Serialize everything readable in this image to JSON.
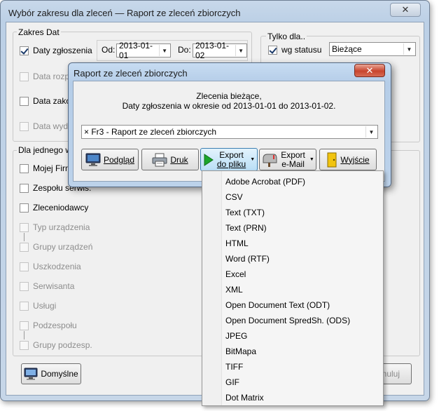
{
  "window": {
    "title": "Wybór zakresu dla zleceń — Raport ze zleceń zbiorczych",
    "close_glyph": "✕"
  },
  "zakres_dat": {
    "legend": "Zakres Dat",
    "rows": [
      {
        "label": "Daty zgłoszenia",
        "checked": true,
        "enabled": true
      },
      {
        "label": "Data rozpo",
        "checked": false,
        "enabled": false
      },
      {
        "label": "Data zako",
        "checked": false,
        "enabled": true
      },
      {
        "label": "Data wyda",
        "checked": false,
        "enabled": false
      }
    ],
    "od_label": "Od:",
    "od_value": "2013-01-01",
    "do_label": "Do:",
    "do_value": "2013-01-02"
  },
  "tylko_dla": {
    "legend": "Tylko dla..",
    "checkbox_label": "wg statusu",
    "status_value": "Bieżące"
  },
  "dla_jednego": {
    "legend": "Dla jednego wy",
    "rows": [
      {
        "label": "Mojej Firmy",
        "enabled": true
      },
      {
        "label": "Zespołu serwis.",
        "enabled": true
      },
      {
        "label": "Zleceniodawcy",
        "enabled": true
      },
      {
        "label": "Typ urządzenia",
        "enabled": false
      },
      {
        "label": "Grupy urządzeń",
        "enabled": false
      },
      {
        "label": "Uszkodzenia",
        "enabled": false
      },
      {
        "label": "Serwisanta",
        "enabled": false
      },
      {
        "label": "Usługi",
        "enabled": false
      },
      {
        "label": "Podzespołu",
        "enabled": false
      },
      {
        "label": "Grupy podzesp.",
        "enabled": false
      }
    ]
  },
  "bottom": {
    "domyslne_label": "Domyślne",
    "anuluj_label": "nuluj"
  },
  "dialog": {
    "title": "Raport ze zleceń zbiorczych",
    "close_glyph": "✕",
    "line1": "Zlecenia bieżące,",
    "line2": "Daty zgłoszenia w okresie  od 2013-01-01  do 2013-01-02.",
    "report_value": "× Fr3 - Raport ze zleceń zbiorczych",
    "buttons": {
      "podglad": "Podgląd",
      "druk": "Druk",
      "export_file_l1": "Export",
      "export_file_l2": "do pliku",
      "export_mail_l1": "Export",
      "export_mail_l2": "e-Mail",
      "wyjscie": "Wyjście"
    }
  },
  "export_menu": {
    "items": [
      "Adobe Acrobat (PDF)",
      "CSV",
      "Text (TXT)",
      "Text (PRN)",
      "HTML",
      "Word (RTF)",
      "Excel",
      "XML",
      "Open Document Text (ODT)",
      "Open Document SpredSh. (ODS)",
      "JPEG",
      "BitMapa",
      "TIFF",
      "GIF",
      "Dot Matrix"
    ]
  },
  "colors": {
    "accent_green": "#1aa52a",
    "close_red": "#c8452e"
  }
}
